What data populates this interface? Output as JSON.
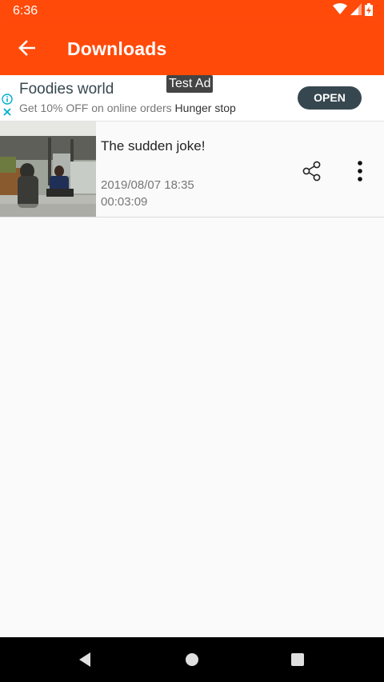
{
  "status_bar": {
    "time": "6:36",
    "icons": [
      "wifi-icon",
      "signal-icon",
      "battery-charging-icon"
    ]
  },
  "app_bar": {
    "title": "Downloads",
    "back_icon": "arrow-back-icon",
    "color": "#ff4a0a"
  },
  "ad": {
    "badge": "Test Ad",
    "title": "Foodies world",
    "description": "Get 10% OFF on online orders",
    "advertiser": "Hunger stop",
    "cta": "OPEN",
    "icons": [
      "info-icon",
      "close-icon"
    ]
  },
  "downloads": [
    {
      "title": "The sudden joke!",
      "date": "2019/08/07 18:35",
      "duration": "00:03:09",
      "actions": [
        "share-icon",
        "more-vert-icon"
      ]
    }
  ],
  "nav_bar": {
    "buttons": [
      "back-triangle-icon",
      "home-circle-icon",
      "recents-square-icon"
    ]
  }
}
